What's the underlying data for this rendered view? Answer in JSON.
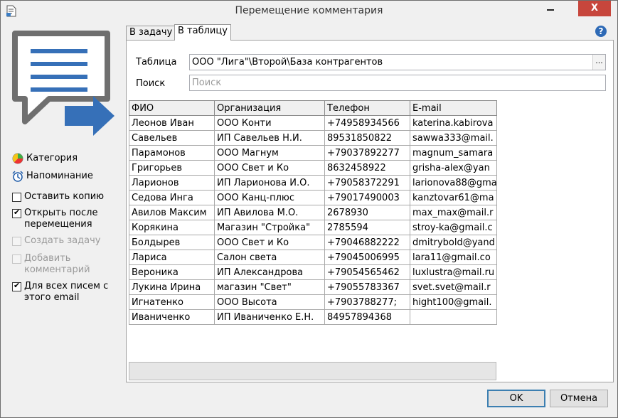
{
  "window": {
    "title": "Перемещение комментария"
  },
  "titlebar": {
    "close_glyph": "X"
  },
  "tabs": [
    {
      "label": "В задачу"
    },
    {
      "label": "В таблицу"
    }
  ],
  "form": {
    "table_label": "Таблица",
    "table_value": "ООО \"Лига\"\\Второй\\База контрагентов",
    "browse_label": "...",
    "search_label": "Поиск",
    "search_placeholder": "Поиск"
  },
  "grid": {
    "columns": [
      "ФИО",
      "Организация",
      "Телефон",
      "E-mail"
    ],
    "rows": [
      [
        "Леонов Иван",
        "ООО Конти",
        "+74958934566",
        "katerina.kabirova"
      ],
      [
        "Савельев",
        "ИП Савельев Н.И.",
        "89531850822",
        "sawwa333@mail."
      ],
      [
        "Парамонов",
        "ООО Магнум",
        "+79037892277",
        "magnum_samara"
      ],
      [
        "Григорьев",
        "ООО Свет и Ко",
        "8632458922",
        "grisha-alex@yan"
      ],
      [
        "Ларионов",
        "ИП Ларионова И.О.",
        "+79058372291",
        "larionova88@gma"
      ],
      [
        "Седова Инга",
        "ООО Канц-плюс",
        "+79017490003",
        "kanztovar61@ma"
      ],
      [
        "Авилов Максим",
        "ИП Авилова М.О.",
        "2678930",
        "max_max@mail.r"
      ],
      [
        "Корякина",
        "Магазин \"Стройка\"",
        "2785594",
        "stroy-ka@gmail.c"
      ],
      [
        "Болдырев",
        "ООО Свет и Ко",
        "+79046882222",
        "dmitrybold@yand"
      ],
      [
        "Лариса",
        "Салон света",
        "+79045006995",
        "lara11@gmail.co"
      ],
      [
        "Вероника",
        "ИП Александрова",
        "+79054565462",
        "luxlustra@mail.ru"
      ],
      [
        "Лукина Ирина",
        "магазин \"Свет\"",
        "+79055783367",
        "svet.svet@mail.r"
      ],
      [
        "Игнатенко",
        "ООО Высота",
        "+7903788277;",
        "hight100@gmail."
      ],
      [
        "Иваниченко",
        "ИП Иваниченко Е.Н.",
        "84957894368",
        ""
      ]
    ]
  },
  "left": {
    "category_label": "Категория",
    "reminder_label": "Напоминание",
    "options": [
      {
        "label": "Оставить копию",
        "checked": false,
        "disabled": false
      },
      {
        "label": "Открыть после перемещения",
        "checked": true,
        "disabled": false
      },
      {
        "label": "Создать задачу",
        "checked": false,
        "disabled": true
      },
      {
        "label": "Добавить комментарий",
        "checked": false,
        "disabled": true
      },
      {
        "label": "Для всех писем с этого email",
        "checked": true,
        "disabled": false
      }
    ]
  },
  "buttons": {
    "ok": "OK",
    "cancel": "Отмена"
  },
  "colors": {
    "accent": "#2e6ab6",
    "close": "#c7463c",
    "icon_gray": "#707070"
  }
}
